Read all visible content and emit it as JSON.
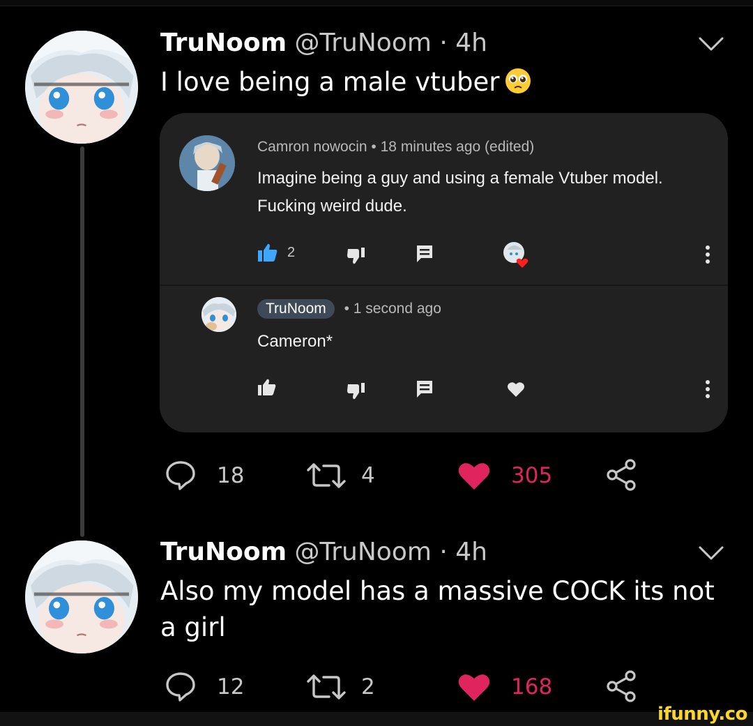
{
  "tweets": [
    {
      "name": "TruNoom",
      "handle": "@TruNoom",
      "separator": "·",
      "time": "4h",
      "text": "I love being a male vtuber",
      "emoji": "pleading-face",
      "replies": "18",
      "retweets": "4",
      "likes": "305"
    },
    {
      "name": "TruNoom",
      "handle": "@TruNoom",
      "separator": "·",
      "time": "4h",
      "text": "Also my model has a massive COCK its not a girl",
      "replies": "12",
      "retweets": "2",
      "likes": "168"
    }
  ],
  "youtube_card": {
    "comment": {
      "author": "Camron nowocin",
      "bullet": "•",
      "time": "18 minutes ago (edited)",
      "text": "Imagine being a guy and using a female Vtuber model. Fucking weird dude.",
      "likes": "2"
    },
    "reply": {
      "author": "TruNoom",
      "bullet": "•",
      "time": "1 second ago",
      "text": "Cameron*"
    }
  },
  "colors": {
    "background": "#000000",
    "card": "#212121",
    "like_active": "#e0245e",
    "youtube_like": "#3ea6ff",
    "watermark": "#fbd62b"
  },
  "watermark": "ifunny.co"
}
